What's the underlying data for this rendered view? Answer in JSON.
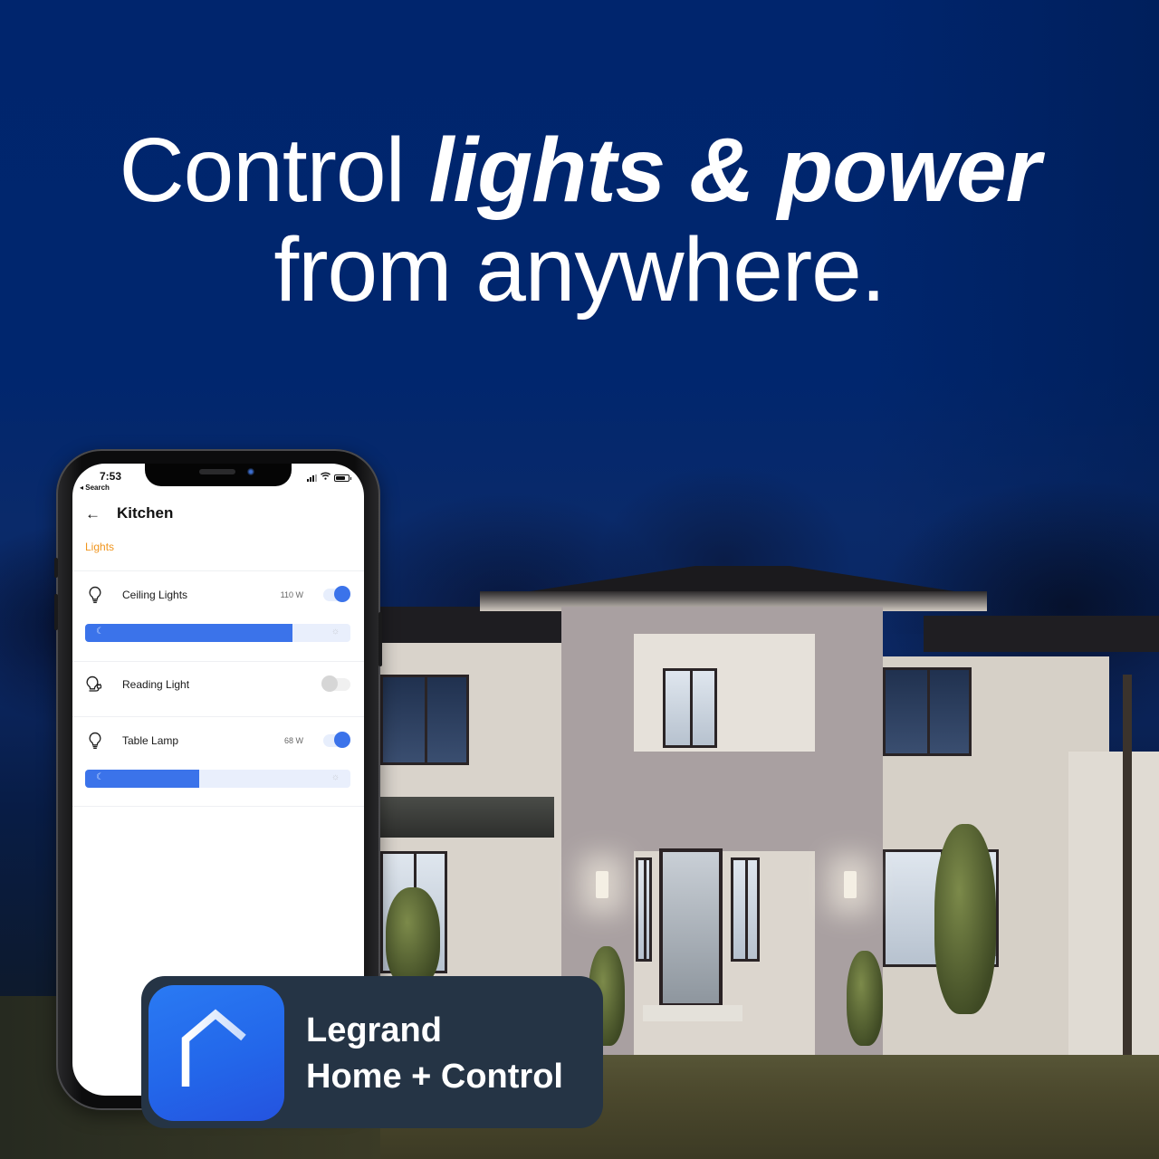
{
  "headline": {
    "line1_regular": "Control ",
    "line1_emphasis": "lights & power",
    "line2": "from anywhere."
  },
  "phone": {
    "status_bar": {
      "time": "7:53",
      "back_link": "◂ Search",
      "wifi_glyph": "≋"
    },
    "header": {
      "back_glyph": "←",
      "title": "Kitchen"
    },
    "section_label": "Lights",
    "devices": [
      {
        "name": "Ceiling Lights",
        "power": "110 W",
        "on": true,
        "brightness": 0.78,
        "icon": "bulb-icon"
      },
      {
        "name": "Reading Light",
        "power": "",
        "on": false,
        "icon": "bulb-plug-icon"
      },
      {
        "name": "Table Lamp",
        "power": "68 W",
        "on": true,
        "brightness": 0.43,
        "icon": "bulb-icon"
      }
    ],
    "slider_glyphs": {
      "moon": "☾",
      "sun": "☼"
    }
  },
  "badge": {
    "line1": "Legrand",
    "line2": "Home + Control"
  },
  "colors": {
    "sky": "#00266c",
    "accent_blue": "#3b73ea",
    "section_orange": "#f0951e",
    "badge_bg": "#253445",
    "app_icon_blue": "#2367ea"
  }
}
